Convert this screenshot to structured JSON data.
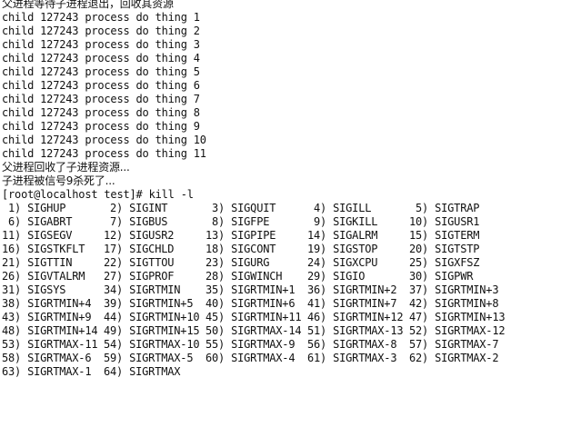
{
  "terminal": {
    "lines": [
      "父进程等待子进程退出，回收其资源",
      "child 127243 process do thing 1",
      "child 127243 process do thing 2",
      "child 127243 process do thing 3",
      "child 127243 process do thing 4",
      "child 127243 process do thing 5",
      "child 127243 process do thing 6",
      "child 127243 process do thing 7",
      "child 127243 process do thing 8",
      "child 127243 process do thing 9",
      "child 127243 process do thing 10",
      "child 127243 process do thing 11",
      "父进程回收了子进程资源...",
      "子进程被信号9杀死了..."
    ],
    "prompt": "[root@localhost test]# kill -l",
    "signal_rows": [
      [
        " 1) SIGHUP",
        " 2) SIGINT",
        " 3) SIGQUIT",
        " 4) SIGILL",
        " 5) SIGTRAP"
      ],
      [
        " 6) SIGABRT",
        " 7) SIGBUS",
        " 8) SIGFPE",
        " 9) SIGKILL",
        "10) SIGUSR1"
      ],
      [
        "11) SIGSEGV",
        "12) SIGUSR2",
        "13) SIGPIPE",
        "14) SIGALRM",
        "15) SIGTERM"
      ],
      [
        "16) SIGSTKFLT",
        "17) SIGCHLD",
        "18) SIGCONT",
        "19) SIGSTOP",
        "20) SIGTSTP"
      ],
      [
        "21) SIGTTIN",
        "22) SIGTTOU",
        "23) SIGURG",
        "24) SIGXCPU",
        "25) SIGXFSZ"
      ],
      [
        "26) SIGVTALRM",
        "27) SIGPROF",
        "28) SIGWINCH",
        "29) SIGIO",
        "30) SIGPWR"
      ],
      [
        "31) SIGSYS",
        "34) SIGRTMIN",
        "35) SIGRTMIN+1",
        "36) SIGRTMIN+2",
        "37) SIGRTMIN+3"
      ],
      [
        "38) SIGRTMIN+4",
        "39) SIGRTMIN+5",
        "40) SIGRTMIN+6",
        "41) SIGRTMIN+7",
        "42) SIGRTMIN+8"
      ],
      [
        "43) SIGRTMIN+9",
        "44) SIGRTMIN+10",
        "45) SIGRTMIN+11",
        "46) SIGRTMIN+12",
        "47) SIGRTMIN+13"
      ],
      [
        "48) SIGRTMIN+14",
        "49) SIGRTMIN+15",
        "50) SIGRTMAX-14",
        "51) SIGRTMAX-13",
        "52) SIGRTMAX-12"
      ],
      [
        "53) SIGRTMAX-11",
        "54) SIGRTMAX-10",
        "55) SIGRTMAX-9",
        "56) SIGRTMAX-8",
        "57) SIGRTMAX-7"
      ],
      [
        "58) SIGRTMAX-6",
        "59) SIGRTMAX-5",
        "60) SIGRTMAX-4",
        "61) SIGRTMAX-3",
        "62) SIGRTMAX-2"
      ],
      [
        "63) SIGRTMAX-1",
        "64) SIGRTMAX"
      ]
    ]
  }
}
